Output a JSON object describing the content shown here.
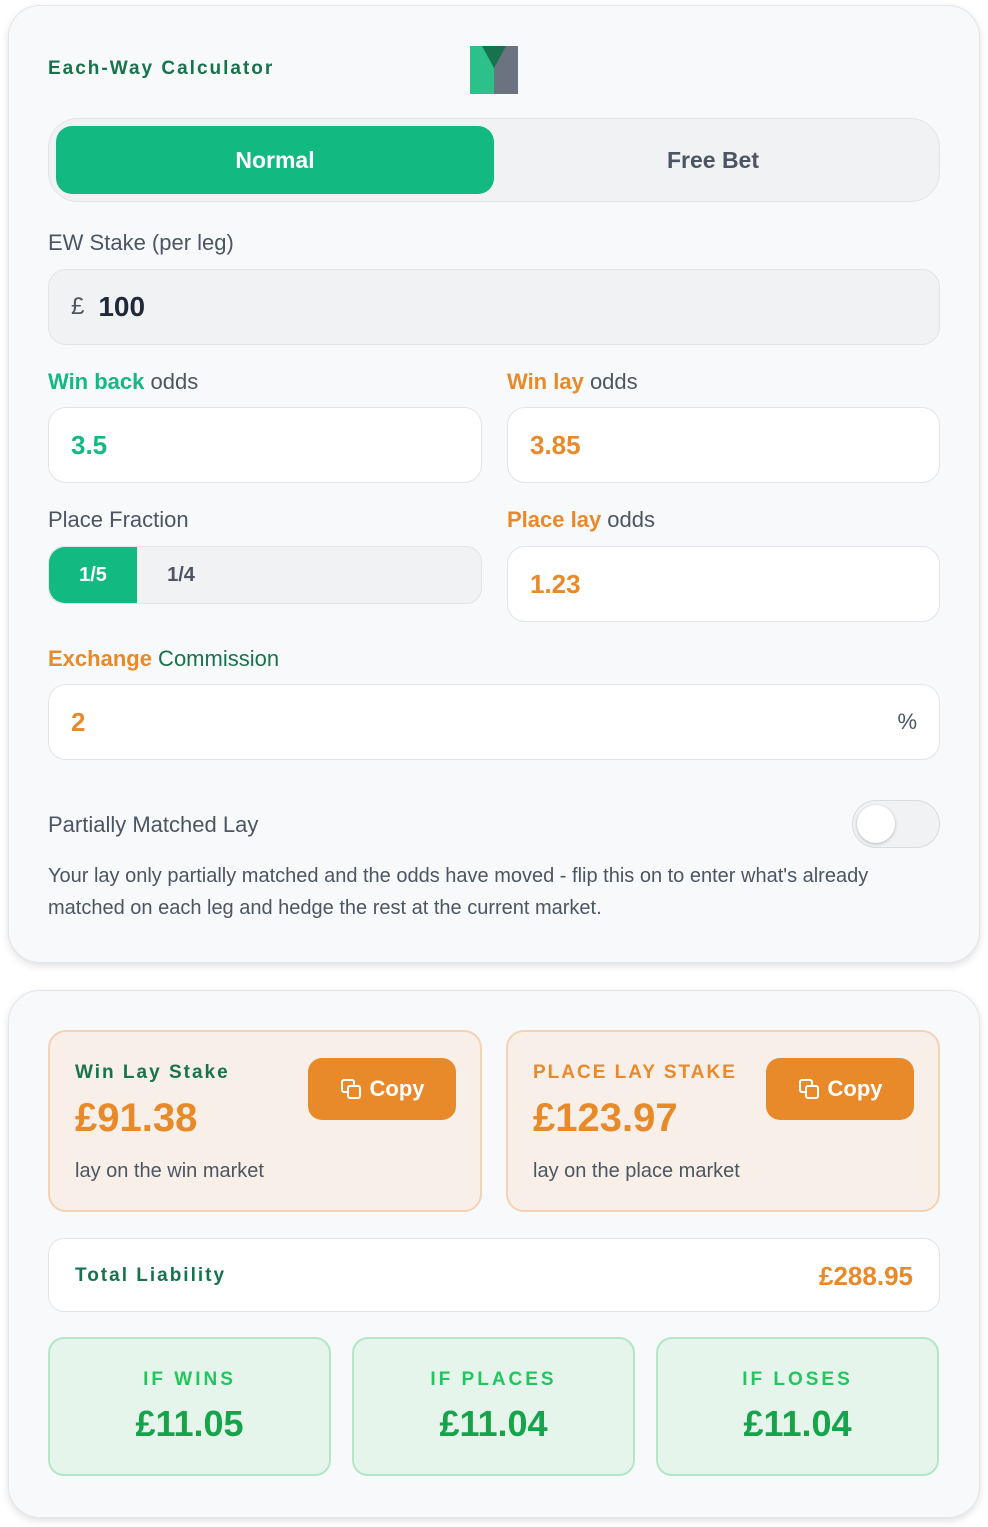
{
  "app": {
    "title": "Each-Way Calculator"
  },
  "colors": {
    "accent_green": "#12b981",
    "accent_orange": "#e8892a",
    "dark_green": "#17734b"
  },
  "mode_toggle": {
    "options": [
      "Normal",
      "Free Bet"
    ],
    "selected": "Normal"
  },
  "stake": {
    "label": "EW Stake (per leg)",
    "currency": "£",
    "value": "100"
  },
  "win_back": {
    "label_strong": "Win back",
    "label_rest": " odds",
    "value": "3.5"
  },
  "win_lay": {
    "label_strong": "Win lay",
    "label_rest": " odds",
    "value": "3.85"
  },
  "place_fraction": {
    "label": "Place Fraction",
    "options": [
      "1/5",
      "1/4"
    ],
    "selected": "1/5"
  },
  "place_lay": {
    "label_strong": "Place lay",
    "label_rest": " odds",
    "value": "1.23"
  },
  "commission": {
    "label_strong": "Exchange",
    "label_rest": " Commission",
    "value": "2",
    "unit": "%"
  },
  "partial": {
    "label": "Partially Matched Lay",
    "enabled": false,
    "description": "Your lay only partially matched and the odds have moved - flip this on to enter what's already matched on each leg and hedge the rest at the current market."
  },
  "results": {
    "win_lay": {
      "title": "Win Lay Stake",
      "amount": "£91.38",
      "sub": "lay on the win market",
      "copy_label": "Copy"
    },
    "place_lay": {
      "title": "PLACE LAY STAKE",
      "amount": "£123.97",
      "sub": "lay on the place market",
      "copy_label": "Copy"
    },
    "liability": {
      "label": "Total Liability",
      "value": "£288.95"
    },
    "outcomes": [
      {
        "label": "IF WINS",
        "value": "£11.05"
      },
      {
        "label": "IF PLACES",
        "value": "£11.04"
      },
      {
        "label": "IF LOSES",
        "value": "£11.04"
      }
    ]
  }
}
